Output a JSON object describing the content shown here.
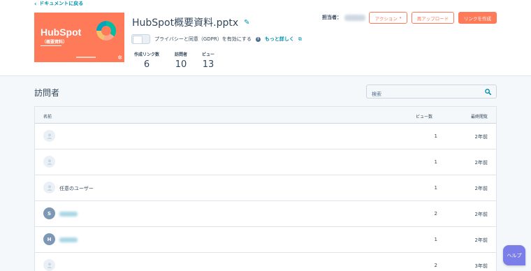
{
  "header": {
    "back_link": "ドキュメントに戻る",
    "document_title": "HubSpot概要資料.pptx",
    "thumbnail": {
      "brand": "HubSpot",
      "subtitle": "（概要資料）"
    },
    "gdpr_label": "プライバシーと同意（GDPR）を有効にする",
    "more_link": "もっと詳しく",
    "owner_label": "担当者："
  },
  "stats": [
    {
      "label": "作成リンク数",
      "value": "6"
    },
    {
      "label": "訪問者",
      "value": "10"
    },
    {
      "label": "ビュー",
      "value": "13"
    }
  ],
  "actions": {
    "action_button": "アクション",
    "reupload_button": "再アップロード",
    "create_link_button": "リンクを作成"
  },
  "visitors": {
    "title": "訪問者",
    "search_placeholder": "検索",
    "columns": {
      "name": "名前",
      "views": "ビュー数",
      "last_viewed": "最終閲覧"
    },
    "rows": [
      {
        "avatar": "",
        "name": "",
        "views": "1",
        "last_viewed": "2年前"
      },
      {
        "avatar": "",
        "name": "",
        "views": "1",
        "last_viewed": "2年前"
      },
      {
        "avatar": "",
        "name": "任意のユーザー",
        "views": "1",
        "last_viewed": "2年前"
      },
      {
        "avatar": "S",
        "name": "",
        "views": "2",
        "last_viewed": "2年前"
      },
      {
        "avatar": "H",
        "name": "",
        "views": "1",
        "last_viewed": "2年前"
      },
      {
        "avatar": "",
        "name": "",
        "views": "2",
        "last_viewed": "3年前"
      }
    ]
  },
  "help_button": "ヘルプ",
  "colors": {
    "accent": "#ff7a59",
    "link": "#0091ae",
    "text": "#33475b",
    "help": "#7b7ee8"
  }
}
